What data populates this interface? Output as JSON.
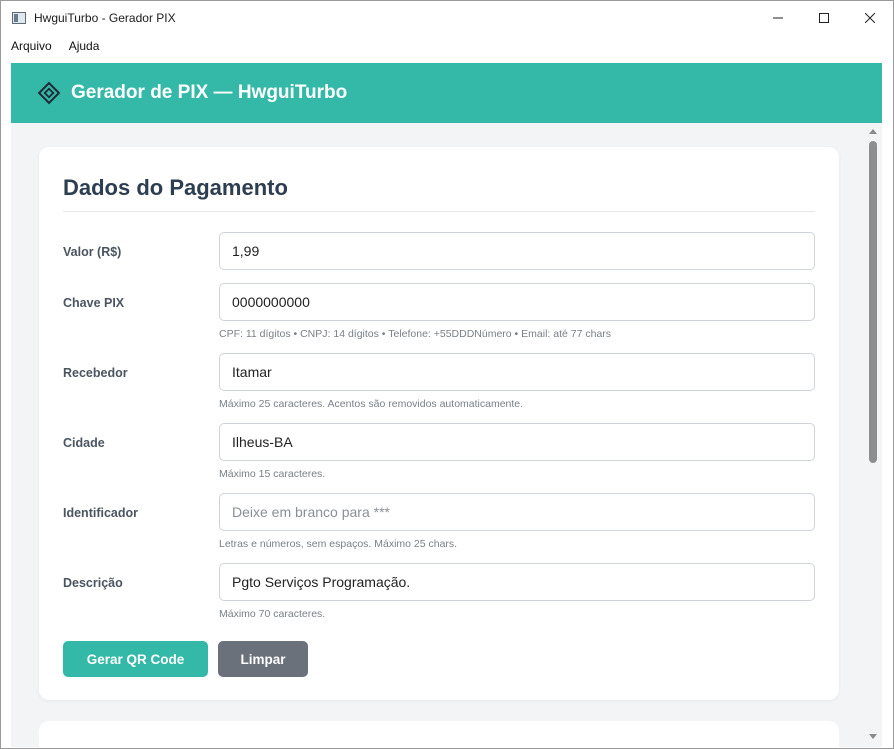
{
  "window": {
    "title": "HwguiTurbo - Gerador PIX",
    "minimize_glyph": "—",
    "maximize_glyph": "☐",
    "close_glyph": "✕"
  },
  "menu": [
    "Arquivo",
    "Ajuda"
  ],
  "header": {
    "title": "Gerador de PIX — HwguiTurbo",
    "icon": "pix-diamond-icon",
    "color": "#34b9a8"
  },
  "form": {
    "title": "Dados do Pagamento",
    "fields": [
      {
        "label": "Valor (R$)",
        "value": "1,99",
        "placeholder": "",
        "hint": ""
      },
      {
        "label": "Chave PIX",
        "value": "0000000000",
        "placeholder": "",
        "hint": "CPF: 11 dígitos • CNPJ: 14 dígitos • Telefone: +55DDDNúmero • Email: até 77 chars"
      },
      {
        "label": "Recebedor",
        "value": "Itamar",
        "placeholder": "",
        "hint": "Máximo 25 caracteres. Acentos são removidos automaticamente."
      },
      {
        "label": "Cidade",
        "value": "Ilheus-BA",
        "placeholder": "",
        "hint": "Máximo 15 caracteres."
      },
      {
        "label": "Identificador",
        "value": "",
        "placeholder": "Deixe em branco para ***",
        "hint": "Letras e números, sem espaços. Máximo 25 chars."
      },
      {
        "label": "Descrição",
        "value": "Pgto Serviços Programação.",
        "placeholder": "",
        "hint": "Máximo 70 caracteres."
      }
    ],
    "buttons": {
      "generate": "Gerar QR Code",
      "clear": "Limpar"
    }
  },
  "colors": {
    "accent": "#34b9a8",
    "secondary_button": "#6b717a",
    "title_text": "#2c3e50"
  }
}
